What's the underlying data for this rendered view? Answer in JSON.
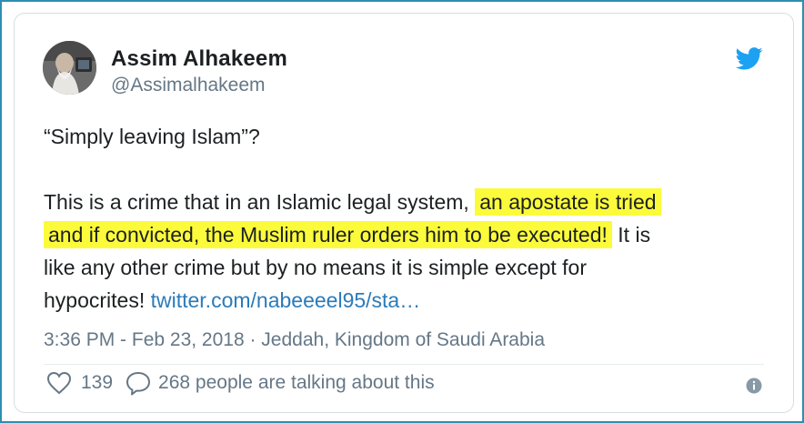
{
  "author": {
    "display_name": "Assim Alhakeem",
    "handle": "@Assimalhakeem",
    "avatar_icon": "user-avatar"
  },
  "tweet": {
    "line1": "“Simply leaving Islam”?",
    "line2_plain": "This is a crime that in an Islamic legal system, ",
    "line2_highlight": "an apostate is tried",
    "line3_highlight": "and if convicted, the Muslim ruler orders him to be executed!",
    "line3_plain": " It is",
    "line4": "like any other crime but by no means it is simple except for",
    "line5_plain": "hypocrites! ",
    "link": "twitter.com/nabeeeel95/sta…"
  },
  "meta": {
    "timestamp": "3:36 PM - Feb 23, 2018 · Jeddah, Kingdom of Saudi Arabia"
  },
  "actions": {
    "like_count": "139",
    "talking": "268 people are talking about this"
  },
  "icons": {
    "brand": "twitter-bird-icon",
    "like": "heart-icon",
    "reply": "speech-bubble-icon",
    "info": "info-icon"
  },
  "colors": {
    "brand": "#1da1f2",
    "highlight": "#fbfb3c",
    "link": "#2b7bb9",
    "frame": "#2e8fb0"
  }
}
